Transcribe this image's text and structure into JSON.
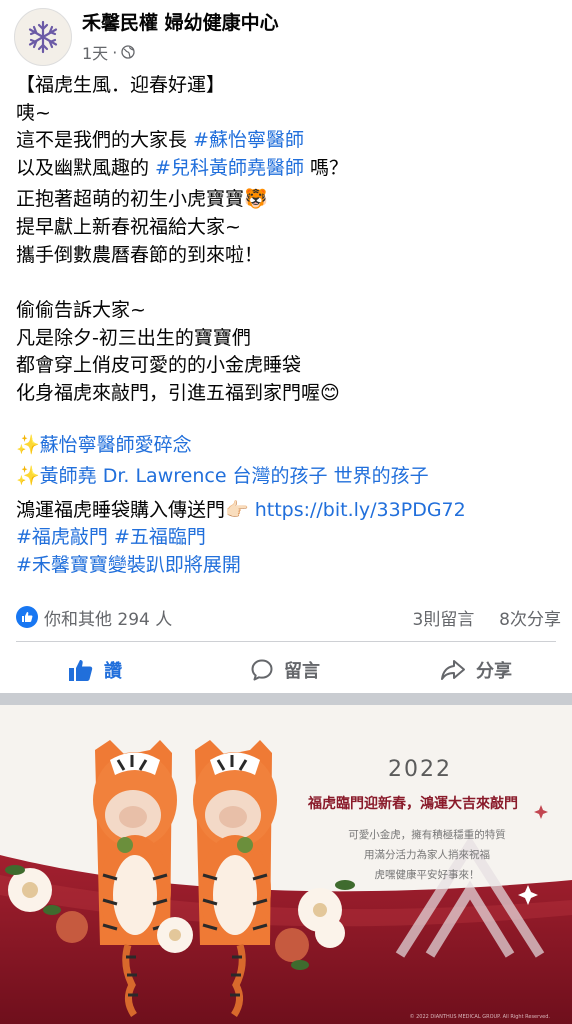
{
  "header": {
    "page_name": "禾馨民權 婦幼健康中心",
    "timestamp": "1天",
    "separator": "·",
    "audience_icon": "globe-icon"
  },
  "post": {
    "lines": [
      {
        "text": "【福虎生風．迎春好運】"
      },
      {
        "text": "咦~"
      },
      {
        "prefix": "這不是我們的大家長 ",
        "hashtag": "#蘇怡寧醫師"
      },
      {
        "prefix": "以及幽默風趣的 ",
        "hashtag": "#兒科黃師堯醫師",
        "suffix": " 嗎？"
      },
      {
        "text": "正抱著超萌的初生小虎寶寶🐯"
      },
      {
        "text": "提早獻上新春祝福給大家~"
      },
      {
        "text": "攜手倒數農曆春節的到來啦！"
      },
      {
        "text": "偷偷告訴大家~"
      },
      {
        "text": "凡是除夕-初三出生的寶寶們"
      },
      {
        "text": "都會穿上俏皮可愛的的小金虎睡袋"
      },
      {
        "text": "化身福虎來敲門，引進五福到家門喔😊"
      },
      {
        "text": "✨蘇怡寧醫師愛碎念"
      },
      {
        "text": "✨黃師堯 Dr. Lawrence 台灣的孩子 世界的孩子"
      },
      {
        "prefix": "鴻運福虎睡袋購入傳送門👉🏻 ",
        "link": "https://bit.ly/33PDG72"
      },
      {
        "text": "#福虎敲門 #五福臨門"
      },
      {
        "text": "#禾馨寶寶變裝趴即將展開"
      }
    ]
  },
  "reactions": {
    "summary": "你和其他 294 人",
    "comments": "3則留言",
    "shares": "8次分享"
  },
  "actions": {
    "like": "讚",
    "comment": "留言",
    "share": "分享"
  },
  "banner": {
    "year": "2022",
    "headline": "福虎臨門迎新春，鴻運大吉來敲門",
    "copy": [
      "可愛小金虎，擁有積極穩重的特質",
      "用滿分活力為家人捎來祝福",
      "虎嘿健康平安好事來！"
    ],
    "copyright": "© 2022 DIANTHUS MEDICAL GROUP. All Right Reserved."
  },
  "colors": {
    "link_blue": "#216fdb",
    "facebook_blue": "#1877f2",
    "banner_red": "#8a1b2b"
  }
}
